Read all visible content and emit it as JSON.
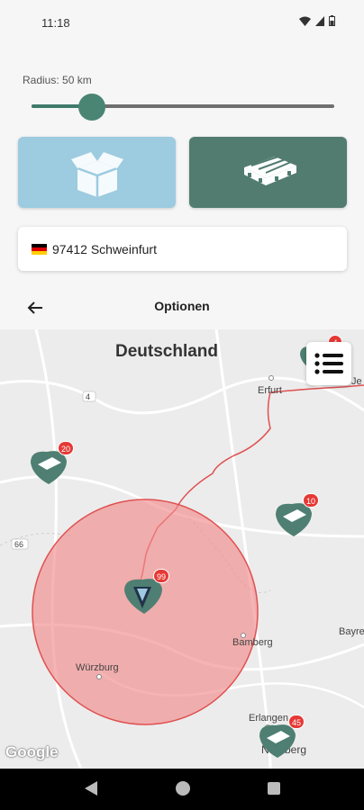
{
  "status_bar": {
    "time": "11:18"
  },
  "filters": {
    "radius_label": "Radius: 50 km",
    "radius_slider_fraction": 0.2,
    "type_buttons": [
      {
        "name": "box",
        "icon": "box-icon",
        "color": "#9dcbe0"
      },
      {
        "name": "pallet",
        "icon": "pallet-icon",
        "color": "#527c70"
      }
    ],
    "location": {
      "flag": "germany-flag-icon",
      "text": "97412 Schweinfurt"
    }
  },
  "options_bar": {
    "title": "Optionen",
    "back_icon": "arrow-left-icon"
  },
  "map": {
    "country_label": "Deutschland",
    "city_labels": [
      "Erfurt",
      "Bamberg",
      "Würzburg",
      "Erlangen",
      "Nürnberg",
      "Bayre",
      "Je"
    ],
    "road_numbers": [
      "4",
      "66"
    ],
    "markers": [
      {
        "count": "20"
      },
      {
        "count": "10"
      },
      {
        "count": "99"
      },
      {
        "count": "45"
      },
      {
        "count": "4"
      }
    ],
    "radius_circle_color": "#f28c8c",
    "attribution": "Google",
    "list_button_icon": "list-icon"
  },
  "colors": {
    "accent": "#3f7b6b",
    "badge": "#e53935",
    "border_line": "#e05050"
  }
}
